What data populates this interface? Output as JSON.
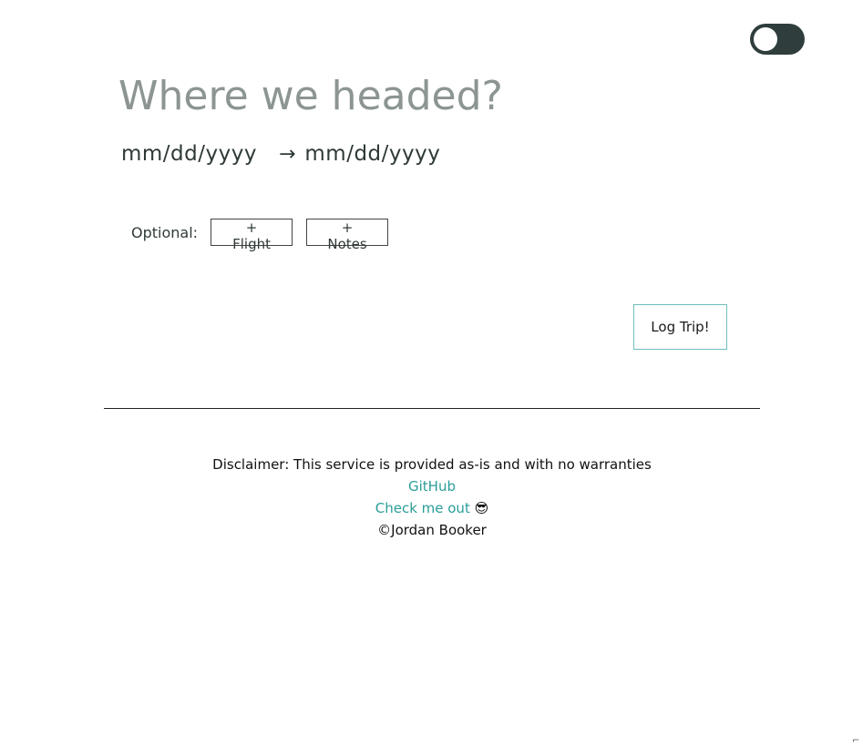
{
  "theme_toggle": {
    "state": "off"
  },
  "destination": {
    "placeholder": "Where we headed?",
    "value": ""
  },
  "dates": {
    "start_placeholder": "mm/dd/yyyy",
    "arrow": "→",
    "end_placeholder": "mm/dd/yyyy"
  },
  "optional": {
    "label": "Optional:",
    "flight_label": "+ Flight",
    "notes_label": "+ Notes"
  },
  "log_button": {
    "label": "Log Trip!"
  },
  "footer": {
    "disclaimer": "Disclaimer: This service is provided as-is and with no warranties",
    "github_label": "GitHub",
    "checkme_label": "Check me out",
    "checkme_emoji": "😎",
    "copyright": "©Jordan Booker"
  },
  "colors": {
    "accent": "#2a9d9a",
    "toggle_bg": "#2f3e3c",
    "log_border": "#6fbdbd"
  }
}
